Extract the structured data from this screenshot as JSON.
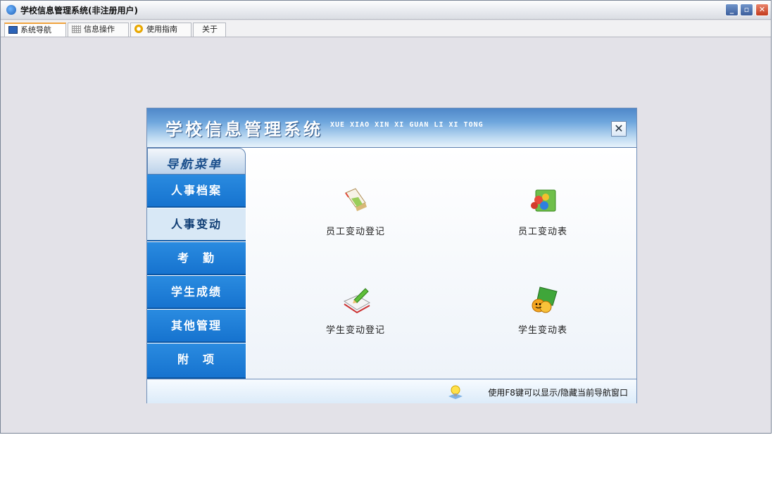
{
  "window": {
    "title": "学校信息管理系统(非注册用户)",
    "controls": {
      "minimize": "_",
      "maximize": "▫",
      "close": "✕"
    }
  },
  "tabs": [
    {
      "label": "系统导航",
      "icon": "nav-window-icon",
      "active": true
    },
    {
      "label": "信息操作",
      "icon": "grid-icon",
      "active": false
    },
    {
      "label": "使用指南",
      "icon": "help-icon",
      "active": false
    },
    {
      "label": "关于",
      "icon": "",
      "active": false
    }
  ],
  "nav_panel": {
    "title": "学校信息管理系统",
    "subtitle": "XUE XIAO XIN XI GUAN LI XI TONG",
    "close_label": "✕",
    "menu_header": "导航菜单",
    "menu_items": [
      {
        "label": "人事档案",
        "active": false
      },
      {
        "label": "人事变动",
        "active": true
      },
      {
        "label": "考　勤",
        "active": false
      },
      {
        "label": "学生成绩",
        "active": false
      },
      {
        "label": "其他管理",
        "active": false
      },
      {
        "label": "附　项",
        "active": false
      }
    ],
    "tiles": [
      {
        "label": "员工变动登记",
        "icon": "notebook-icon"
      },
      {
        "label": "员工变动表",
        "icon": "folder-people-icon"
      },
      {
        "label": "学生变动登记",
        "icon": "notepad-pencil-icon"
      },
      {
        "label": "学生变动表",
        "icon": "smiley-icon"
      }
    ],
    "status_text": "使用F8键可以显示/隐藏当前导航窗口",
    "status_icon": "lightbulb-icon"
  }
}
